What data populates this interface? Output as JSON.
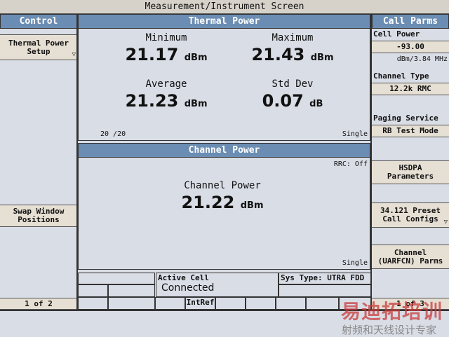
{
  "title": "Measurement/Instrument Screen",
  "control": {
    "header": "Control",
    "thermal_setup": [
      "Thermal Power",
      "Setup"
    ],
    "swap": [
      "Swap Window",
      "Positions"
    ],
    "page": "1 of 2"
  },
  "thermal": {
    "header": "Thermal Power",
    "min_label": "Minimum",
    "min_value": "21.17",
    "min_unit": "dBm",
    "max_label": "Maximum",
    "max_value": "21.43",
    "max_unit": "dBm",
    "avg_label": "Average",
    "avg_value": "21.23",
    "avg_unit": "dBm",
    "std_label": "Std Dev",
    "std_value": "0.07",
    "std_unit": "dB",
    "count": "20 /20",
    "mode": "Single"
  },
  "channel": {
    "header": "Channel Power",
    "rrc": "RRC: Off",
    "label": "Channel Power",
    "value": "21.22",
    "unit": "dBm",
    "mode": "Single"
  },
  "status": {
    "active_cell_label": "Active Cell",
    "active_cell_value": "Connected",
    "sys_type": "Sys Type: UTRA FDD",
    "intref": "IntRef"
  },
  "call_parms": {
    "header": "Call Parms",
    "cell_power_label": "Cell Power",
    "cell_power_value": "-93.00",
    "cell_power_unit": "dBm/3.84 MHz",
    "channel_type_label": "Channel Type",
    "channel_type_value": "12.2k RMC",
    "paging_label": "Paging Service",
    "paging_value": "RB Test Mode",
    "hsdpa": [
      "HSDPA",
      "Parameters"
    ],
    "preset": [
      "34.121 Preset",
      "Call Configs"
    ],
    "uarfcn": [
      "Channel",
      "(UARFCN) Parms"
    ],
    "page": "1 of 3"
  },
  "watermark": {
    "line1": "易迪拓培训",
    "line2": "射频和天线设计专家"
  }
}
